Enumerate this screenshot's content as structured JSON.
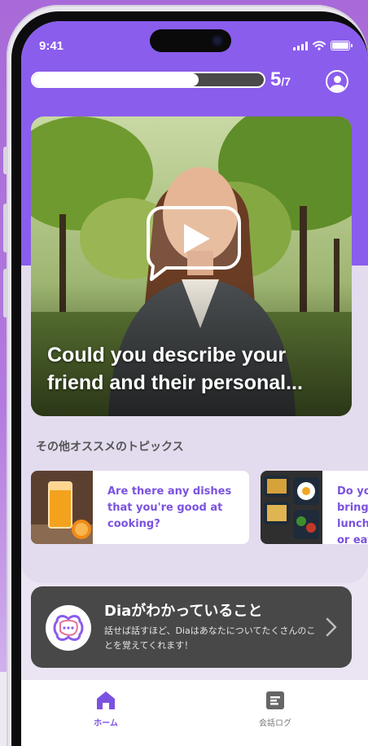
{
  "status_bar": {
    "time": "9:41"
  },
  "progress": {
    "current": "5",
    "total": "/7",
    "fraction": 0.72
  },
  "hero": {
    "caption": "Could you describe your friend and their personal..."
  },
  "other_topics": {
    "title": "その他オススメのトピックス",
    "items": [
      {
        "text": "Are there any dishes that you're good at cooking?",
        "image": "orange-juice-photo"
      },
      {
        "text": "Do you bring lunch or eat out?",
        "image": "lunchbox-photo"
      }
    ]
  },
  "dia_card": {
    "title": "Diaがわかっていること",
    "description": "話せば話すほど、Diaはあなたについてたくさんのことを覚えてくれます！"
  },
  "nav": {
    "home": "ホーム",
    "log": "会話ログ"
  },
  "colors": {
    "accent": "#8a5ded",
    "card_dark": "#484848"
  },
  "icons": [
    "profile-icon",
    "play-icon",
    "chevron-right-icon",
    "home-icon",
    "log-icon",
    "dia-logo-icon"
  ]
}
